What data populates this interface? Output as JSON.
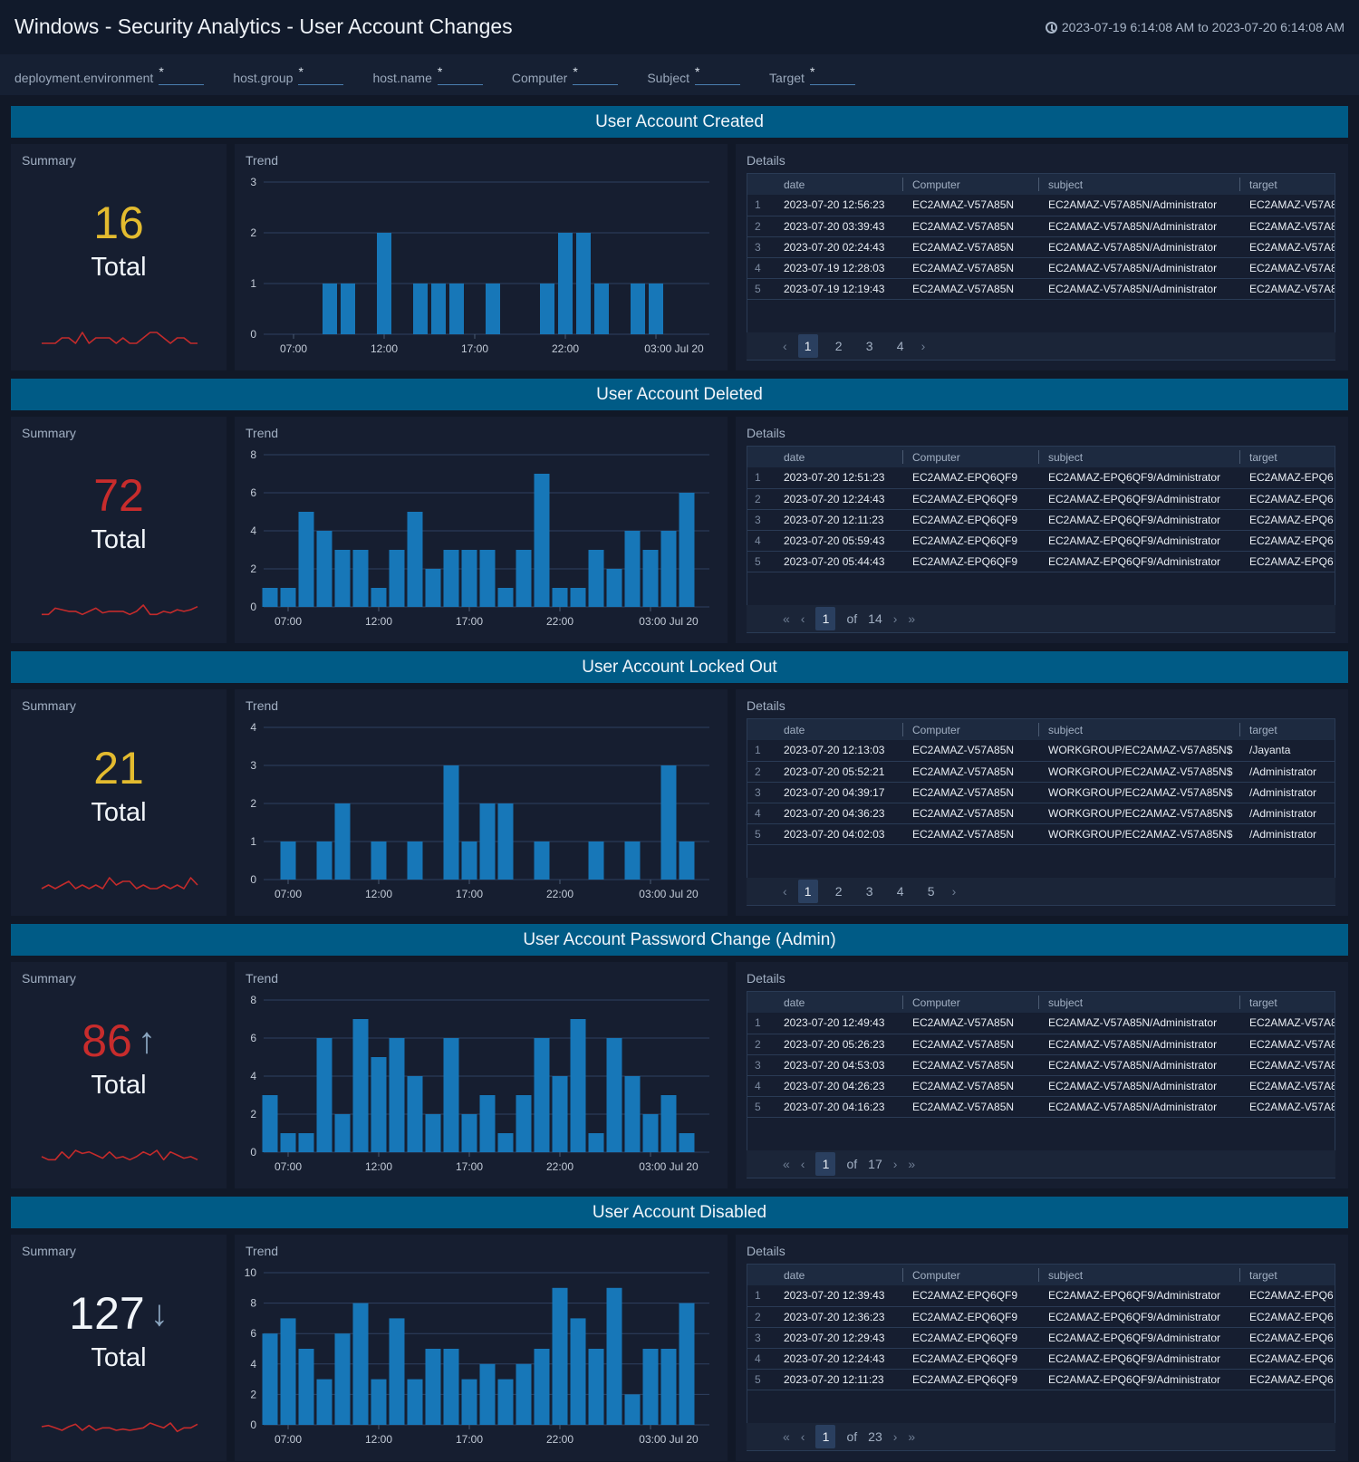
{
  "header": {
    "title": "Windows - Security Analytics - User Account Changes",
    "time_range": "2023-07-19 6:14:08 AM to 2023-07-20 6:14:08 AM",
    "time_icon": "clock-icon"
  },
  "filters": [
    {
      "label": "deployment.environment",
      "value": "*"
    },
    {
      "label": "host.group",
      "value": "*"
    },
    {
      "label": "host.name",
      "value": "*"
    },
    {
      "label": "Computer",
      "value": "*"
    },
    {
      "label": "Subject",
      "value": "*"
    },
    {
      "label": "Target",
      "value": "*"
    }
  ],
  "panel_titles": {
    "summary": "Summary",
    "trend": "Trend",
    "details": "Details"
  },
  "table_columns": [
    "date",
    "Computer",
    "subject",
    "target"
  ],
  "colors": {
    "bar": "#1777b8",
    "spark": "#c42b2b",
    "yellow": "#e3bb2f",
    "red": "#c82c2c",
    "white": "#f1f5f9",
    "banner": "#005b86"
  },
  "chart_data": [
    {
      "type": "bar",
      "title": "User Account Created",
      "xlabel": "",
      "ylabel": "",
      "x_ticks": [
        "07:00",
        "12:00",
        "17:00",
        "22:00",
        "03:00 Jul 20"
      ],
      "slots": 24,
      "values": [
        0,
        0,
        0,
        1,
        1,
        0,
        2,
        0,
        1,
        1,
        1,
        0,
        1,
        0,
        0,
        1,
        2,
        2,
        1,
        0,
        1,
        1,
        0,
        0
      ],
      "ylim": [
        0,
        3
      ],
      "y_ticks": [
        0,
        1,
        2,
        3
      ]
    },
    {
      "type": "bar",
      "title": "User Account Deleted",
      "xlabel": "",
      "ylabel": "",
      "x_ticks": [
        "07:00",
        "12:00",
        "17:00",
        "22:00",
        "03:00 Jul 20"
      ],
      "slots": 24,
      "values": [
        1,
        1,
        5,
        4,
        3,
        3,
        1,
        3,
        5,
        2,
        3,
        3,
        3,
        1,
        3,
        7,
        1,
        1,
        3,
        2,
        4,
        3,
        4,
        6
      ],
      "ylim": [
        0,
        8
      ],
      "y_ticks": [
        0,
        2,
        4,
        6,
        8
      ]
    },
    {
      "type": "bar",
      "title": "User Account Locked Out",
      "xlabel": "",
      "ylabel": "",
      "x_ticks": [
        "07:00",
        "12:00",
        "17:00",
        "22:00",
        "03:00 Jul 20"
      ],
      "slots": 24,
      "values": [
        0,
        1,
        0,
        1,
        2,
        0,
        1,
        0,
        1,
        0,
        3,
        1,
        2,
        2,
        0,
        1,
        0,
        0,
        1,
        0,
        1,
        0,
        3,
        1
      ],
      "ylim": [
        0,
        4
      ],
      "y_ticks": [
        0,
        1,
        2,
        3,
        4
      ]
    },
    {
      "type": "bar",
      "title": "User Account Password Change (Admin)",
      "xlabel": "",
      "ylabel": "",
      "x_ticks": [
        "07:00",
        "12:00",
        "17:00",
        "22:00",
        "03:00 Jul 20"
      ],
      "slots": 24,
      "values": [
        3,
        1,
        1,
        6,
        2,
        7,
        5,
        6,
        4,
        2,
        6,
        2,
        3,
        1,
        3,
        6,
        4,
        7,
        1,
        6,
        4,
        2,
        3,
        1
      ],
      "ylim": [
        0,
        8
      ],
      "y_ticks": [
        0,
        2,
        4,
        6,
        8
      ]
    },
    {
      "type": "bar",
      "title": "User Account Disabled",
      "xlabel": "",
      "ylabel": "",
      "x_ticks": [
        "07:00",
        "12:00",
        "17:00",
        "22:00",
        "03:00 Jul 20"
      ],
      "slots": 24,
      "values": [
        6,
        7,
        5,
        3,
        6,
        8,
        3,
        7,
        3,
        5,
        5,
        3,
        4,
        3,
        4,
        5,
        9,
        7,
        5,
        9,
        2,
        5,
        5,
        8
      ],
      "ylim": [
        0,
        10
      ],
      "y_ticks": [
        0,
        2,
        4,
        6,
        8,
        10
      ]
    }
  ],
  "sections": [
    {
      "title": "User Account Created",
      "summary": {
        "value": "16",
        "label": "Total",
        "color": "#e3bb2f",
        "arrow": ""
      },
      "rows": [
        [
          "1",
          "2023-07-20 12:56:23",
          "EC2AMAZ-V57A85N",
          "EC2AMAZ-V57A85N/Administrator",
          "EC2AMAZ-V57A8"
        ],
        [
          "2",
          "2023-07-20 03:39:43",
          "EC2AMAZ-V57A85N",
          "EC2AMAZ-V57A85N/Administrator",
          "EC2AMAZ-V57A8"
        ],
        [
          "3",
          "2023-07-20 02:24:43",
          "EC2AMAZ-V57A85N",
          "EC2AMAZ-V57A85N/Administrator",
          "EC2AMAZ-V57A8"
        ],
        [
          "4",
          "2023-07-19 12:28:03",
          "EC2AMAZ-V57A85N",
          "EC2AMAZ-V57A85N/Administrator",
          "EC2AMAZ-V57A8"
        ],
        [
          "5",
          "2023-07-19 12:19:43",
          "EC2AMAZ-V57A85N",
          "EC2AMAZ-V57A85N/Administrator",
          "EC2AMAZ-V57A8"
        ]
      ],
      "pager": {
        "type": "pages",
        "prev": "‹",
        "next": "›",
        "pages": [
          "1",
          "2",
          "3",
          "4"
        ],
        "active": "1"
      }
    },
    {
      "title": "User Account Deleted",
      "summary": {
        "value": "72",
        "label": "Total",
        "color": "#c82c2c",
        "arrow": ""
      },
      "rows": [
        [
          "1",
          "2023-07-20 12:51:23",
          "EC2AMAZ-EPQ6QF9",
          "EC2AMAZ-EPQ6QF9/Administrator",
          "EC2AMAZ-EPQ6"
        ],
        [
          "2",
          "2023-07-20 12:24:43",
          "EC2AMAZ-EPQ6QF9",
          "EC2AMAZ-EPQ6QF9/Administrator",
          "EC2AMAZ-EPQ6"
        ],
        [
          "3",
          "2023-07-20 12:11:23",
          "EC2AMAZ-EPQ6QF9",
          "EC2AMAZ-EPQ6QF9/Administrator",
          "EC2AMAZ-EPQ6"
        ],
        [
          "4",
          "2023-07-20 05:59:43",
          "EC2AMAZ-EPQ6QF9",
          "EC2AMAZ-EPQ6QF9/Administrator",
          "EC2AMAZ-EPQ6"
        ],
        [
          "5",
          "2023-07-20 05:44:43",
          "EC2AMAZ-EPQ6QF9",
          "EC2AMAZ-EPQ6QF9/Administrator",
          "EC2AMAZ-EPQ6"
        ]
      ],
      "pager": {
        "type": "of",
        "first": "«",
        "prev": "‹",
        "current": "1",
        "of": "of",
        "total": "14",
        "next": "›",
        "last": "»"
      }
    },
    {
      "title": "User Account Locked Out",
      "summary": {
        "value": "21",
        "label": "Total",
        "color": "#e3bb2f",
        "arrow": ""
      },
      "rows": [
        [
          "1",
          "2023-07-20 12:13:03",
          "EC2AMAZ-V57A85N",
          "WORKGROUP/EC2AMAZ-V57A85N$",
          "/Jayanta"
        ],
        [
          "2",
          "2023-07-20 05:52:21",
          "EC2AMAZ-V57A85N",
          "WORKGROUP/EC2AMAZ-V57A85N$",
          "/Administrator"
        ],
        [
          "3",
          "2023-07-20 04:39:17",
          "EC2AMAZ-V57A85N",
          "WORKGROUP/EC2AMAZ-V57A85N$",
          "/Administrator"
        ],
        [
          "4",
          "2023-07-20 04:36:23",
          "EC2AMAZ-V57A85N",
          "WORKGROUP/EC2AMAZ-V57A85N$",
          "/Administrator"
        ],
        [
          "5",
          "2023-07-20 04:02:03",
          "EC2AMAZ-V57A85N",
          "WORKGROUP/EC2AMAZ-V57A85N$",
          "/Administrator"
        ]
      ],
      "pager": {
        "type": "pages",
        "prev": "‹",
        "next": "›",
        "pages": [
          "1",
          "2",
          "3",
          "4",
          "5"
        ],
        "active": "1"
      }
    },
    {
      "title": "User Account Password Change (Admin)",
      "summary": {
        "value": "86",
        "label": "Total",
        "color": "#c82c2c",
        "arrow": "↑"
      },
      "rows": [
        [
          "1",
          "2023-07-20 12:49:43",
          "EC2AMAZ-V57A85N",
          "EC2AMAZ-V57A85N/Administrator",
          "EC2AMAZ-V57A8"
        ],
        [
          "2",
          "2023-07-20 05:26:23",
          "EC2AMAZ-V57A85N",
          "EC2AMAZ-V57A85N/Administrator",
          "EC2AMAZ-V57A8"
        ],
        [
          "3",
          "2023-07-20 04:53:03",
          "EC2AMAZ-V57A85N",
          "EC2AMAZ-V57A85N/Administrator",
          "EC2AMAZ-V57A8"
        ],
        [
          "4",
          "2023-07-20 04:26:23",
          "EC2AMAZ-V57A85N",
          "EC2AMAZ-V57A85N/Administrator",
          "EC2AMAZ-V57A8"
        ],
        [
          "5",
          "2023-07-20 04:16:23",
          "EC2AMAZ-V57A85N",
          "EC2AMAZ-V57A85N/Administrator",
          "EC2AMAZ-V57A8"
        ]
      ],
      "pager": {
        "type": "of",
        "first": "«",
        "prev": "‹",
        "current": "1",
        "of": "of",
        "total": "17",
        "next": "›",
        "last": "»"
      }
    },
    {
      "title": "User Account Disabled",
      "summary": {
        "value": "127",
        "label": "Total",
        "color": "#f1f5f9",
        "arrow": "↓"
      },
      "rows": [
        [
          "1",
          "2023-07-20 12:39:43",
          "EC2AMAZ-EPQ6QF9",
          "EC2AMAZ-EPQ6QF9/Administrator",
          "EC2AMAZ-EPQ6"
        ],
        [
          "2",
          "2023-07-20 12:36:23",
          "EC2AMAZ-EPQ6QF9",
          "EC2AMAZ-EPQ6QF9/Administrator",
          "EC2AMAZ-EPQ6"
        ],
        [
          "3",
          "2023-07-20 12:29:43",
          "EC2AMAZ-EPQ6QF9",
          "EC2AMAZ-EPQ6QF9/Administrator",
          "EC2AMAZ-EPQ6"
        ],
        [
          "4",
          "2023-07-20 12:24:43",
          "EC2AMAZ-EPQ6QF9",
          "EC2AMAZ-EPQ6QF9/Administrator",
          "EC2AMAZ-EPQ6"
        ],
        [
          "5",
          "2023-07-20 12:11:23",
          "EC2AMAZ-EPQ6QF9",
          "EC2AMAZ-EPQ6QF9/Administrator",
          "EC2AMAZ-EPQ6"
        ]
      ],
      "pager": {
        "type": "of",
        "first": "«",
        "prev": "‹",
        "current": "1",
        "of": "of",
        "total": "23",
        "next": "›",
        "last": "»"
      }
    }
  ]
}
